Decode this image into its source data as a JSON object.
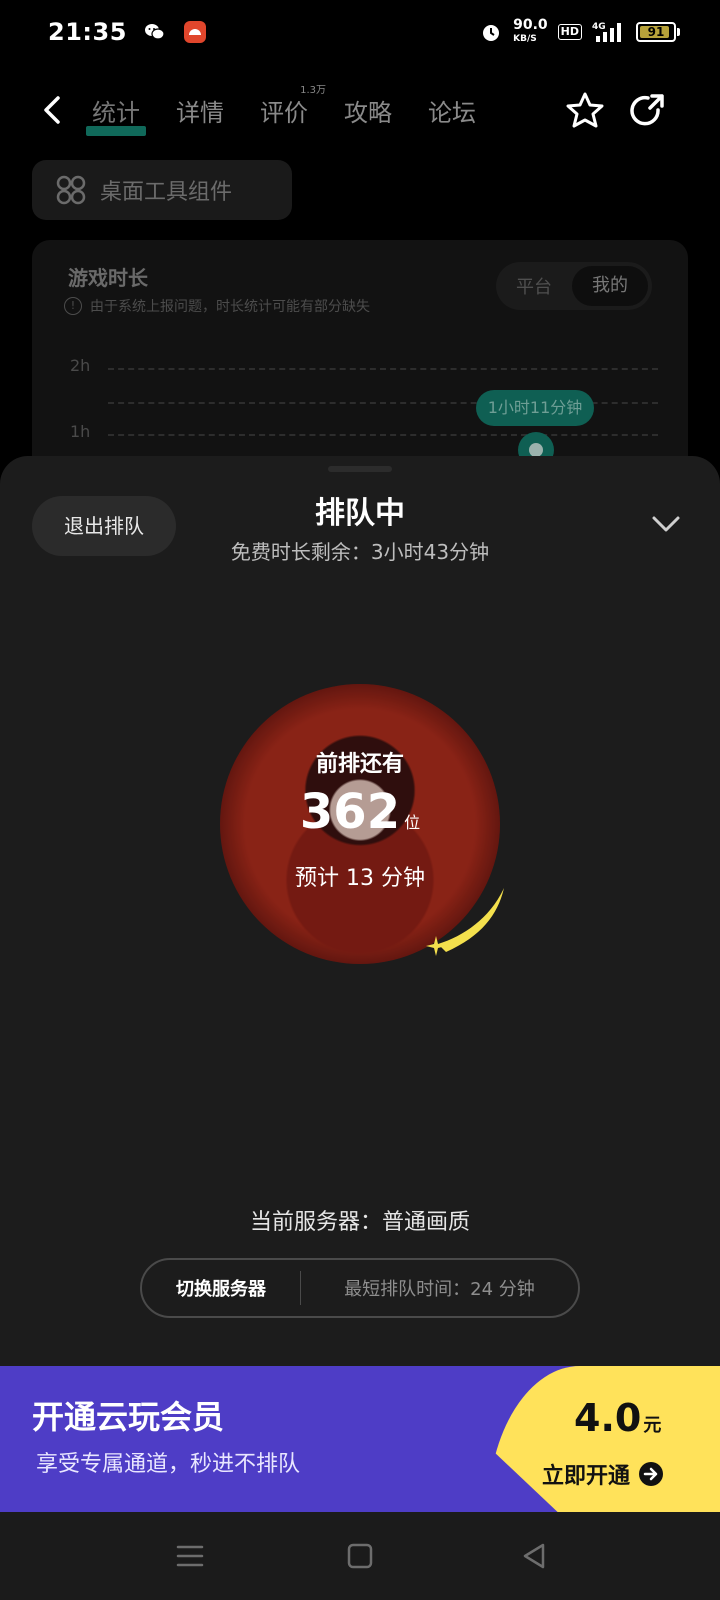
{
  "status_bar": {
    "time": "21:35",
    "speed": "90.0",
    "speed_unit": "KB/S",
    "hd": "HD",
    "network": "4G",
    "battery": "91",
    "battery_level": 0.91,
    "icons": [
      "wechat-icon",
      "app-notification-icon",
      "alarm-icon",
      "signal-icon",
      "battery-icon"
    ]
  },
  "nav": {
    "tabs": [
      {
        "label": "统计",
        "active": true
      },
      {
        "label": "详情",
        "active": false
      },
      {
        "label": "评价",
        "active": false,
        "badge": "1.3万"
      },
      {
        "label": "攻略",
        "active": false
      },
      {
        "label": "论坛",
        "active": false
      }
    ],
    "icons": [
      "back-icon",
      "favorite-star-icon",
      "share-icon"
    ]
  },
  "widget_button": {
    "label": "桌面工具组件"
  },
  "stats_card": {
    "title": "游戏时长",
    "note": "由于系统上报问题，时长统计可能有部分缺失",
    "segments": [
      "平台",
      "我的"
    ],
    "active_segment": "我的",
    "y_labels": [
      "2h",
      "1h"
    ],
    "tooltip": "1小时11分钟"
  },
  "queue_sheet": {
    "exit_label": "退出排队",
    "title": "排队中",
    "subtitle": "免费时长剩余：3小时43分钟",
    "ahead_label": "前排还有",
    "ahead_count": "362",
    "ahead_unit": "位",
    "estimate": "预计 13 分钟",
    "server_line": "当前服务器：普通画质",
    "switch_label": "切换服务器",
    "shortest_label": "最短排队时间：24 分钟"
  },
  "banner": {
    "title": "开通云玩会员",
    "subtitle": "享受专属通道，秒进不排队",
    "price": "4.0",
    "price_unit": "元",
    "cta": "立即开通"
  },
  "colors": {
    "accent_green": "#0f5f53",
    "banner_purple": "#4e3dc6",
    "banner_yellow": "#ffe25a",
    "comet_yellow": "#f4e04d"
  }
}
